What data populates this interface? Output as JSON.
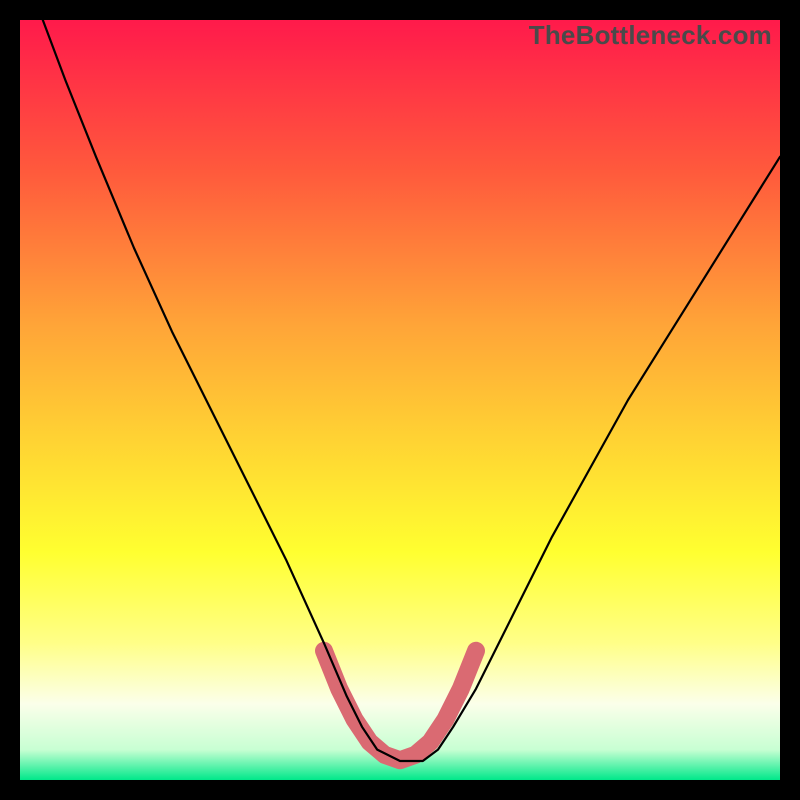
{
  "watermark": "TheBottleneck.com",
  "chart_data": {
    "type": "line",
    "title": "",
    "xlabel": "",
    "ylabel": "",
    "xlim": [
      0,
      100
    ],
    "ylim": [
      0,
      100
    ],
    "grid": false,
    "legend": false,
    "background_gradient": {
      "stops": [
        {
          "offset": 0.0,
          "color": "#ff1a4b"
        },
        {
          "offset": 0.2,
          "color": "#ff5a3c"
        },
        {
          "offset": 0.4,
          "color": "#ffa438"
        },
        {
          "offset": 0.55,
          "color": "#ffd233"
        },
        {
          "offset": 0.7,
          "color": "#ffff30"
        },
        {
          "offset": 0.82,
          "color": "#ffff88"
        },
        {
          "offset": 0.9,
          "color": "#fbffea"
        },
        {
          "offset": 0.96,
          "color": "#c8ffd3"
        },
        {
          "offset": 1.0,
          "color": "#00e88a"
        }
      ]
    },
    "series": [
      {
        "name": "bottleneck-curve",
        "x": [
          3,
          6,
          10,
          15,
          20,
          25,
          30,
          35,
          40,
          43,
          45,
          47,
          50,
          53,
          55,
          57,
          60,
          65,
          70,
          75,
          80,
          85,
          90,
          95,
          100
        ],
        "y": [
          100,
          92,
          82,
          70,
          59,
          49,
          39,
          29,
          18,
          11,
          7,
          4,
          2.5,
          2.5,
          4,
          7,
          12,
          22,
          32,
          41,
          50,
          58,
          66,
          74,
          82
        ],
        "stroke": "#000000",
        "stroke_width": 2.2
      },
      {
        "name": "bottom-highlight",
        "x": [
          40,
          42,
          44,
          46,
          48,
          50,
          52,
          54,
          56,
          58,
          60
        ],
        "y": [
          17,
          12,
          8,
          5,
          3.3,
          2.6,
          3.3,
          5,
          8,
          12,
          17
        ],
        "stroke": "#da6a72",
        "stroke_width": 18,
        "linecap": "round"
      }
    ]
  }
}
